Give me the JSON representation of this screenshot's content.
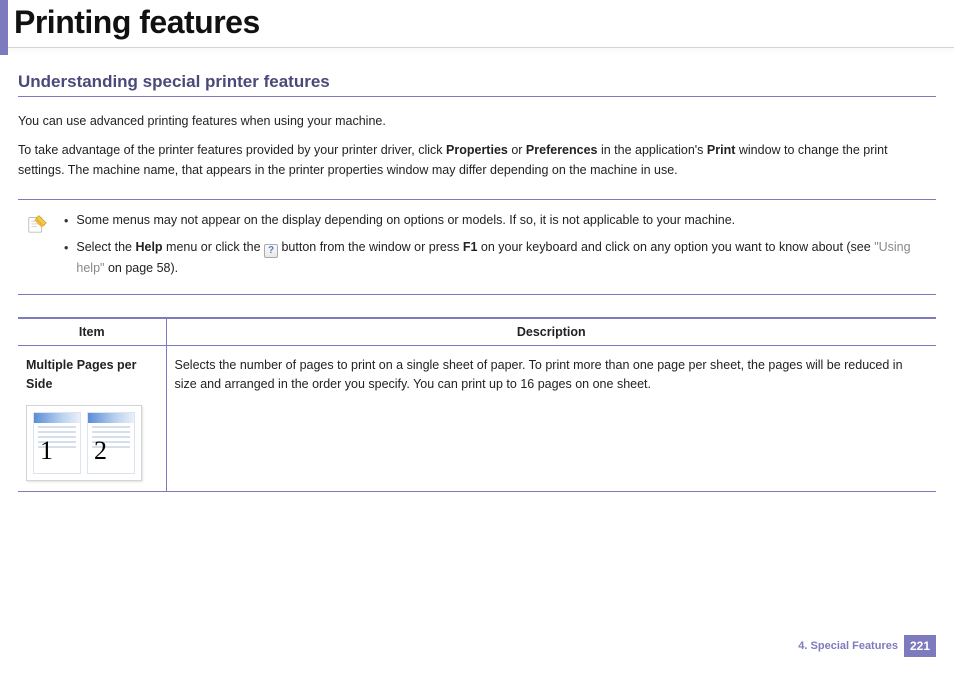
{
  "header": {
    "page_title": "Printing features"
  },
  "section": {
    "title": "Understanding special printer features",
    "intro1": "You can use advanced printing features when using your machine.",
    "intro2_pre": "To take advantage of the printer features provided by your printer driver, click ",
    "intro2_b1": "Properties",
    "intro2_mid1": " or ",
    "intro2_b2": "Preferences",
    "intro2_mid2": " in the application's ",
    "intro2_b3": "Print",
    "intro2_post": " window to change the print settings. The machine name, that appears in the printer properties window may differ depending on the machine in use."
  },
  "note": {
    "items": [
      {
        "text": "Some menus may not appear on the display depending on options or models. If so, it is not applicable to your machine."
      },
      {
        "pre": "Select the ",
        "b1": "Help",
        "mid1": " menu or click the ",
        "mid2": " button from the window or press ",
        "b2": "F1",
        "post": " on your keyboard and click on any option you want to know about (see ",
        "link": "\"Using help\"",
        "post2": " on page 58)."
      }
    ]
  },
  "table": {
    "headers": {
      "item": "Item",
      "desc": "Description"
    },
    "rows": [
      {
        "item_label": "Multiple Pages per Side",
        "thumb_nums": [
          "1",
          "2"
        ],
        "desc": "Selects the number of pages to print on a single sheet of paper. To print more than one page per sheet, the pages will be reduced in size and arranged in the order you specify. You can print up to 16 pages on one sheet."
      }
    ]
  },
  "footer": {
    "chapter": "4.  Special Features",
    "page": "221"
  }
}
